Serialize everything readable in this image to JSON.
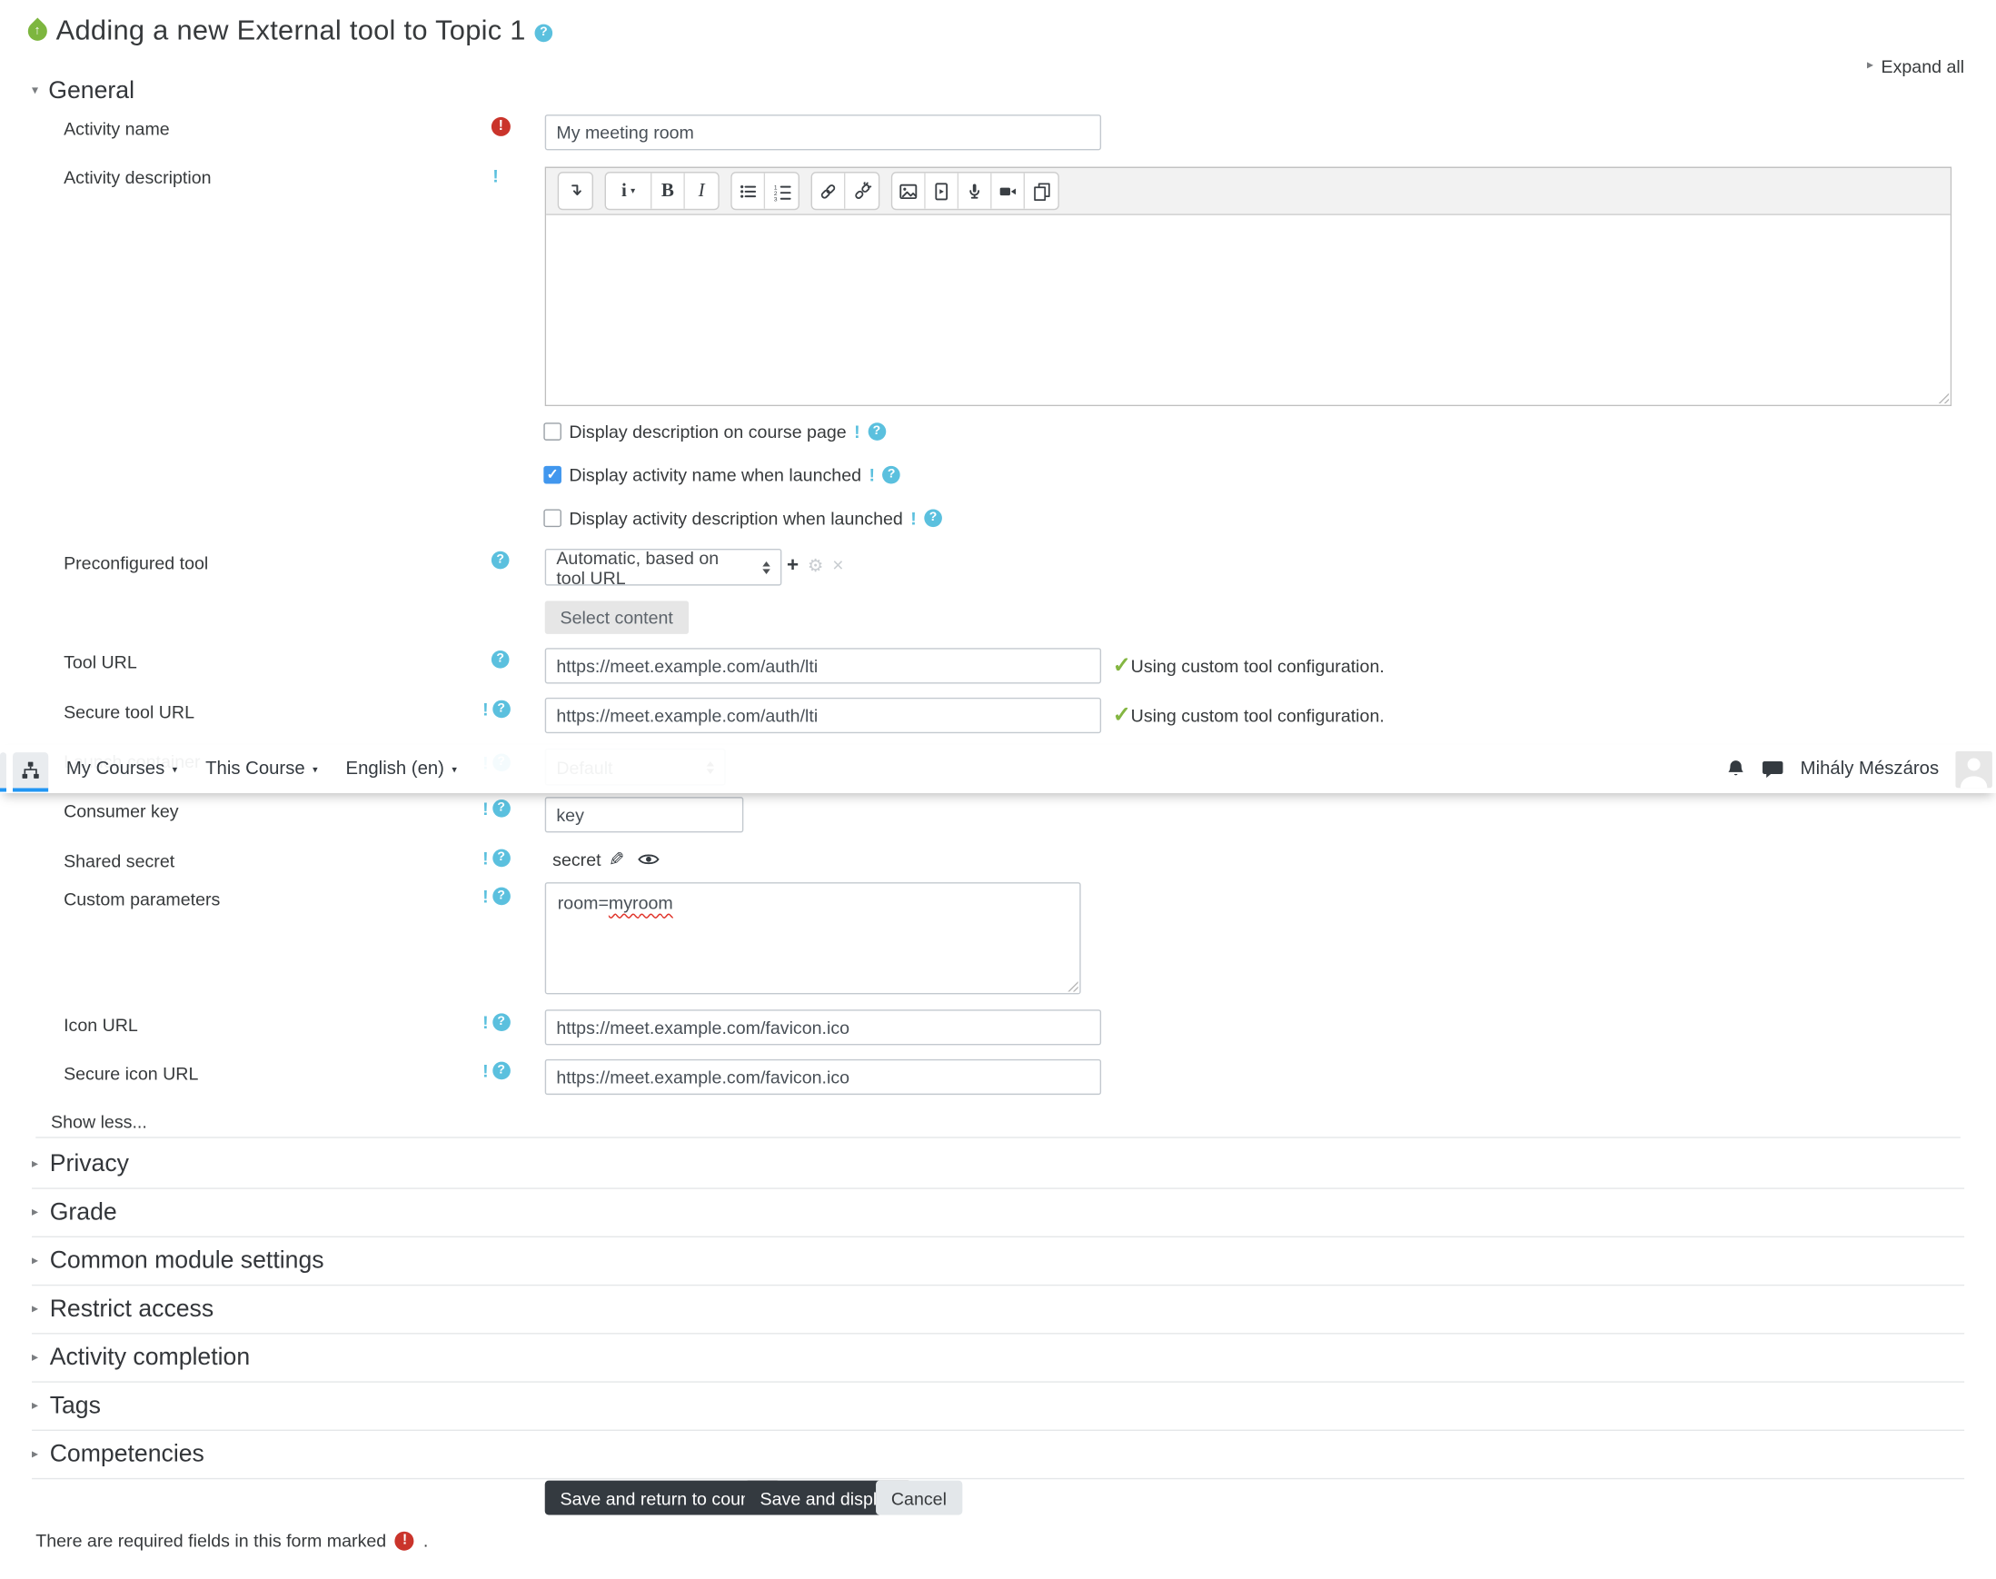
{
  "colors": {
    "accent_blue": "#2196f3",
    "help_blue": "#5bc0de",
    "required_red": "#ca342b",
    "success_green": "#84b642",
    "checkbox_blue": "#4197ee",
    "button_dark": "#343a40",
    "lti_green": "#7db63f"
  },
  "glyphs": {
    "help": "?",
    "advanced": "!",
    "required": "!",
    "check": "✓",
    "caret_down": "▾",
    "caret_right": "▸",
    "plus": "+",
    "gear": "⚙",
    "cross": "×",
    "pencil": "✎",
    "bold": "B",
    "italic": "I",
    "styles": "i",
    "up_arrow": "↑"
  },
  "header": {
    "title": "Adding a new External tool to Topic 1",
    "expand_all": "Expand all"
  },
  "navbar": {
    "items": [
      "My Courses",
      "This Course",
      "English (en)"
    ],
    "user_name": "Mihály Mészáros",
    "icons": [
      "sitemap-icon",
      "bell-icon",
      "chat-icon",
      "avatar"
    ]
  },
  "general": {
    "heading": "General",
    "activity_name": {
      "label": "Activity name",
      "value": "My meeting room"
    },
    "activity_description": {
      "label": "Activity description",
      "toolbar": [
        "collapse",
        "paragraph-styles",
        "bold",
        "italic",
        "unordered-list",
        "ordered-list",
        "link",
        "unlink",
        "insert-image",
        "insert-media",
        "record-audio",
        "record-video",
        "manage-files"
      ],
      "content": ""
    },
    "checkboxes": [
      {
        "label": "Display description on course page",
        "checked": false
      },
      {
        "label": "Display activity name when launched",
        "checked": true
      },
      {
        "label": "Display activity description when launched",
        "checked": false
      }
    ],
    "preconfigured_tool": {
      "label": "Preconfigured tool",
      "value": "Automatic, based on tool URL"
    },
    "select_content_button": "Select content",
    "tool_url": {
      "label": "Tool URL",
      "value": "https://meet.example.com/auth/lti",
      "note": "Using custom tool configuration."
    },
    "secure_tool_url": {
      "label": "Secure tool URL",
      "value": "https://meet.example.com/auth/lti",
      "note": "Using custom tool configuration."
    },
    "launch_container": {
      "label": "Launch container",
      "value": "Default"
    },
    "consumer_key": {
      "label": "Consumer key",
      "value": "key"
    },
    "shared_secret": {
      "label": "Shared secret",
      "value": "secret"
    },
    "custom_parameters": {
      "label": "Custom parameters",
      "value_prefix": "room=",
      "value_word": "myroom"
    },
    "icon_url": {
      "label": "Icon URL",
      "value": "https://meet.example.com/favicon.ico"
    },
    "secure_icon_url": {
      "label": "Secure icon URL",
      "value": "https://meet.example.com/favicon.ico"
    },
    "show_less": "Show less..."
  },
  "sections": [
    "Privacy",
    "Grade",
    "Common module settings",
    "Restrict access",
    "Activity completion",
    "Tags",
    "Competencies"
  ],
  "actions": {
    "save_return": "Save and return to course",
    "save_display": "Save and display",
    "cancel": "Cancel"
  },
  "footer": {
    "required_note": "There are required fields in this form marked",
    "suffix": "."
  }
}
